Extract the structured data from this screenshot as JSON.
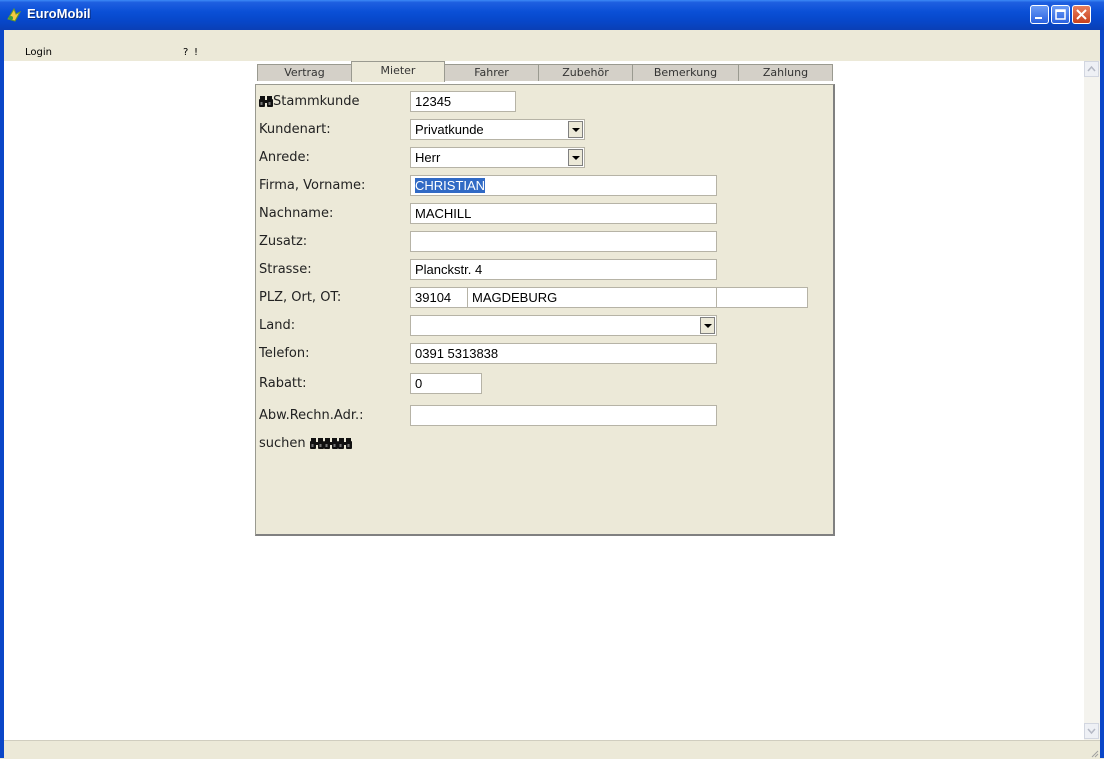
{
  "window": {
    "title": "EuroMobil"
  },
  "menu": {
    "items": [
      "Login",
      "?",
      "!"
    ]
  },
  "tabs": [
    {
      "label": "Vertrag",
      "active": false
    },
    {
      "label": "Mieter",
      "active": true
    },
    {
      "label": "Fahrer",
      "active": false
    },
    {
      "label": "Zubehör",
      "active": false
    },
    {
      "label": "Bemerkung",
      "active": false
    },
    {
      "label": "Zahlung",
      "active": false
    }
  ],
  "form": {
    "stammkunde": {
      "label": "Stammkunde",
      "icon": "binoculars-icon",
      "value": "12345"
    },
    "kundenart": {
      "label": "Kundenart:",
      "value": "Privatkunde"
    },
    "anrede": {
      "label": "Anrede:",
      "value": "Herr"
    },
    "vorname": {
      "label": "Firma, Vorname:",
      "value": "CHRISTIAN",
      "selected": true
    },
    "nachname": {
      "label": "Nachname:",
      "value": "MACHILL"
    },
    "zusatz": {
      "label": "Zusatz:",
      "value": ""
    },
    "strasse": {
      "label": "Strasse:",
      "value": "Planckstr. 4"
    },
    "plz_ort": {
      "label": "PLZ, Ort, OT:",
      "plz": "39104",
      "ort": "MAGDEBURG",
      "ot": ""
    },
    "land": {
      "label": "Land:",
      "value": ""
    },
    "telefon": {
      "label": "Telefon:",
      "value": "0391 5313838"
    },
    "rabatt": {
      "label": "Rabatt:",
      "value": "0"
    },
    "abw_adr": {
      "label": "Abw.Rechn.Adr.:",
      "value": ""
    },
    "suchen": {
      "label": "suchen",
      "icons": [
        "binoculars-icon",
        "binoculars-icon",
        "binoculars-icon"
      ]
    }
  },
  "colors": {
    "titlebar": "#0a4fd6",
    "panel": "#ece9d8",
    "selection": "#316ac5"
  }
}
